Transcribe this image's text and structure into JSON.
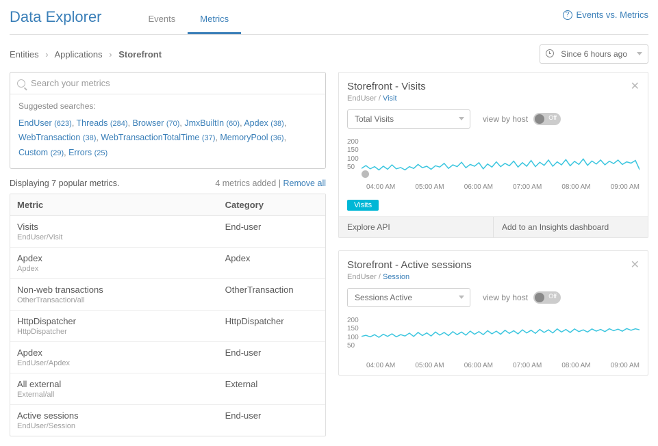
{
  "header": {
    "title": "Data Explorer",
    "tabs": [
      "Events",
      "Metrics"
    ],
    "active_tab": 1,
    "help_link": "Events vs. Metrics"
  },
  "breadcrumb": [
    "Entities",
    "Applications",
    "Storefront"
  ],
  "timepicker": {
    "label": "Since 6 hours ago"
  },
  "search": {
    "placeholder": "Search your metrics",
    "suggested_label": "Suggested searches:",
    "tags": [
      {
        "name": "EndUser",
        "count": 623
      },
      {
        "name": "Threads",
        "count": 284
      },
      {
        "name": "Browser",
        "count": 70
      },
      {
        "name": "JmxBuiltIn",
        "count": 60
      },
      {
        "name": "Apdex",
        "count": 38
      },
      {
        "name": "WebTransaction",
        "count": 38
      },
      {
        "name": "WebTransactionTotalTime",
        "count": 37
      },
      {
        "name": "MemoryPool",
        "count": 36
      },
      {
        "name": "Custom",
        "count": 29
      },
      {
        "name": "Errors",
        "count": 25
      }
    ]
  },
  "list": {
    "displaying": "Displaying 7 popular metrics.",
    "added": "4 metrics added",
    "remove_all": "Remove all",
    "columns": [
      "Metric",
      "Category"
    ],
    "rows": [
      {
        "name": "Visits",
        "path": "EndUser/Visit",
        "category": "End-user"
      },
      {
        "name": "Apdex",
        "path": "Apdex",
        "category": "Apdex"
      },
      {
        "name": "Non-web transactions",
        "path": "OtherTransaction/all",
        "category": "OtherTransaction"
      },
      {
        "name": "HttpDispatcher",
        "path": "HttpDispatcher",
        "category": "HttpDispatcher"
      },
      {
        "name": "Apdex",
        "path": "EndUser/Apdex",
        "category": "End-user"
      },
      {
        "name": "All external",
        "path": "External/all",
        "category": "External"
      },
      {
        "name": "Active sessions",
        "path": "EndUser/Session",
        "category": "End-user"
      }
    ]
  },
  "charts": [
    {
      "title": "Storefront - Visits",
      "sub_dim": "EndUser /",
      "sub_link": "Visit",
      "select": "Total Visits",
      "viewby_label": "view by host",
      "toggle_state": "Off",
      "legend": "Visits",
      "action_explore": "Explore API",
      "action_dashboard": "Add to an Insights dashboard"
    },
    {
      "title": "Storefront - Active sessions",
      "sub_dim": "EndUser /",
      "sub_link": "Session",
      "select": "Sessions Active",
      "viewby_label": "view by host",
      "toggle_state": "Off"
    }
  ],
  "chart_data": [
    {
      "type": "line",
      "title": "Storefront - Visits",
      "ylabel": "",
      "ylim": [
        50,
        200
      ],
      "y_ticks": [
        200,
        150,
        100,
        50
      ],
      "x_ticks": [
        "04:00 AM",
        "05:00 AM",
        "06:00 AM",
        "07:00 AM",
        "08:00 AM",
        "09:00 AM"
      ],
      "series": [
        {
          "name": "Visits",
          "color": "#3cc6df",
          "values": [
            62,
            75,
            60,
            70,
            55,
            72,
            58,
            78,
            60,
            66,
            55,
            70,
            62,
            80,
            65,
            72,
            58,
            74,
            68,
            85,
            62,
            78,
            70,
            90,
            65,
            80,
            72,
            88,
            60,
            82,
            68,
            92,
            70,
            85,
            74,
            95,
            68,
            88,
            72,
            98,
            70,
            90,
            76,
            100,
            72,
            92,
            78,
            102,
            74,
            94,
            80,
            105,
            76,
            96,
            82,
            100,
            78,
            95,
            84,
            100,
            80,
            92,
            86,
            98,
            55
          ]
        }
      ]
    },
    {
      "type": "line",
      "title": "Storefront - Active sessions",
      "ylabel": "",
      "ylim": [
        50,
        200
      ],
      "y_ticks": [
        200,
        150,
        100,
        50
      ],
      "x_ticks": [
        "04:00 AM",
        "05:00 AM",
        "06:00 AM",
        "07:00 AM",
        "08:00 AM",
        "09:00 AM"
      ],
      "series": [
        {
          "name": "Sessions",
          "color": "#3cc6df",
          "values": [
            110,
            115,
            108,
            118,
            106,
            120,
            110,
            122,
            108,
            118,
            112,
            125,
            110,
            128,
            114,
            126,
            112,
            130,
            116,
            128,
            114,
            132,
            118,
            130,
            116,
            134,
            120,
            132,
            118,
            136,
            122,
            134,
            120,
            138,
            124,
            136,
            122,
            140,
            126,
            138,
            124,
            142,
            128,
            140,
            126,
            144,
            130,
            142,
            128,
            144,
            132,
            140,
            130,
            144,
            134,
            142,
            132,
            145,
            136,
            143,
            134,
            146,
            138,
            145,
            140
          ]
        }
      ]
    }
  ]
}
